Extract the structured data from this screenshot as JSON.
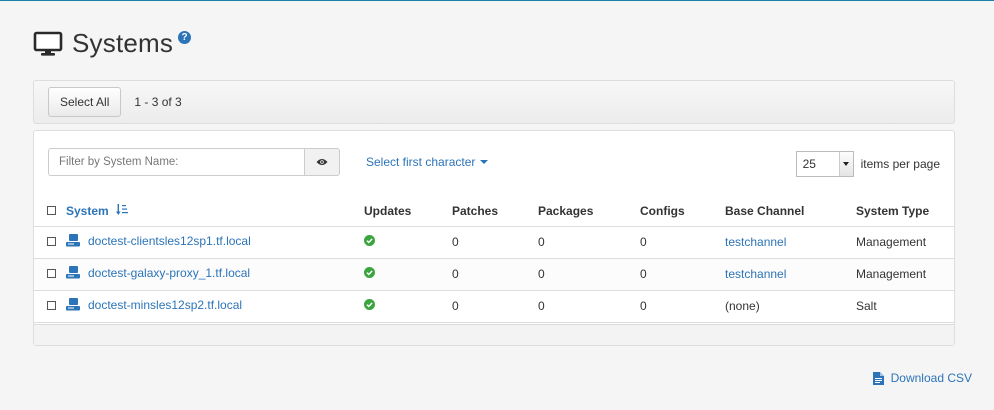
{
  "page": {
    "title": "Systems",
    "help_glyph": "?"
  },
  "toolbar": {
    "select_all_label": "Select All",
    "count_text": "1 - 3 of 3"
  },
  "filter": {
    "placeholder": "Filter by System Name:",
    "value": "",
    "select_first_label": "Select first character"
  },
  "pagination": {
    "items_per_page_value": "25",
    "items_per_page_label": "items per page"
  },
  "table": {
    "columns": [
      "System",
      "Updates",
      "Patches",
      "Packages",
      "Configs",
      "Base Channel",
      "System Type"
    ],
    "rows": [
      {
        "system": "doctest-clientsles12sp1.tf.local",
        "updates": "ok",
        "patches": "0",
        "packages": "0",
        "configs": "0",
        "base_channel": "testchannel",
        "base_channel_link": true,
        "system_type": "Management"
      },
      {
        "system": "doctest-galaxy-proxy_1.tf.local",
        "updates": "ok",
        "patches": "0",
        "packages": "0",
        "configs": "0",
        "base_channel": "testchannel",
        "base_channel_link": true,
        "system_type": "Management"
      },
      {
        "system": "doctest-minsles12sp2.tf.local",
        "updates": "ok",
        "patches": "0",
        "packages": "0",
        "configs": "0",
        "base_channel": "(none)",
        "base_channel_link": false,
        "system_type": "Salt"
      }
    ]
  },
  "footer": {
    "download_label": "Download CSV"
  },
  "icons": {
    "title": "monitor-icon",
    "help": "question-circle-icon",
    "filter": "eye-icon",
    "sort": "sort-alpha-icon",
    "system": "desktop-icon",
    "updates": "check-circle-icon",
    "download": "file-csv-icon"
  },
  "colors": {
    "link": "#2c74b8",
    "success": "#3aa53e",
    "accent_rule": "#1b7faa"
  }
}
